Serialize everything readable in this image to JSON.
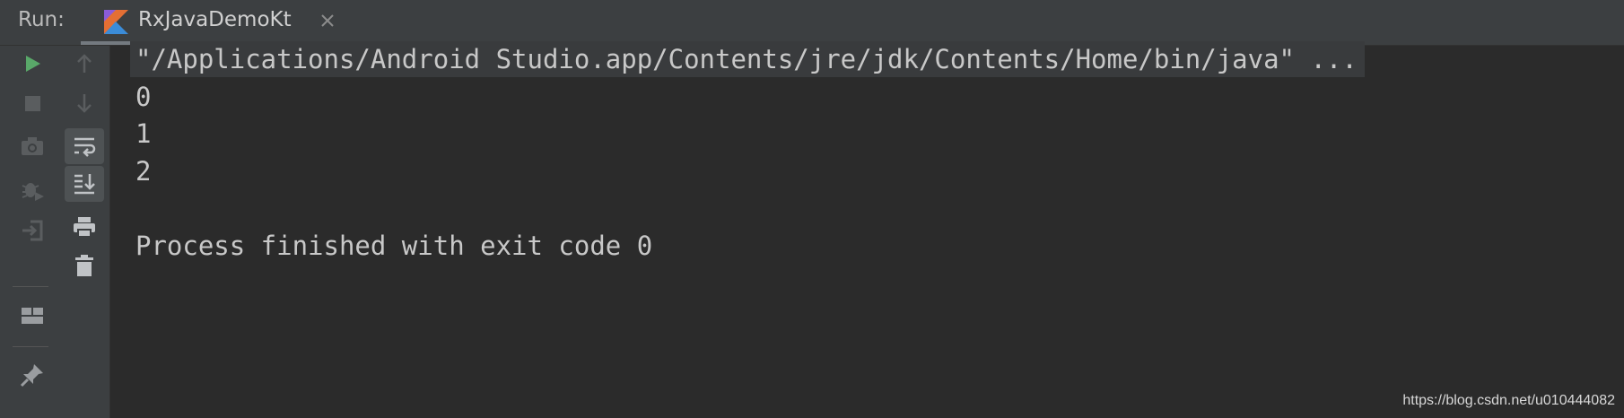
{
  "header": {
    "run_label": "Run:",
    "tab": {
      "title": "RxJavaDemoKt",
      "icon": "kotlin-file-icon",
      "close_icon": "close-icon"
    }
  },
  "toolbar_left": [
    {
      "name": "rerun-button",
      "icon": "play-icon",
      "color": "#59a869"
    },
    {
      "name": "stop-button",
      "icon": "stop-icon"
    },
    {
      "name": "dump-threads-button",
      "icon": "camera-icon"
    },
    {
      "name": "debug-button",
      "icon": "debug-icon"
    },
    {
      "name": "exit-button",
      "icon": "exit-icon"
    },
    {
      "name": "restore-layout-button",
      "icon": "layout-icon"
    },
    {
      "name": "pin-tab-button",
      "icon": "pin-icon"
    }
  ],
  "toolbar_right": [
    {
      "name": "up-button",
      "icon": "arrow-up-icon"
    },
    {
      "name": "down-button",
      "icon": "arrow-down-icon"
    },
    {
      "name": "soft-wrap-button",
      "icon": "soft-wrap-icon",
      "active": true
    },
    {
      "name": "scroll-to-end-button",
      "icon": "scroll-to-end-icon",
      "active": true
    },
    {
      "name": "print-button",
      "icon": "print-icon"
    },
    {
      "name": "clear-all-button",
      "icon": "trash-icon"
    }
  ],
  "console": {
    "command": "\"/Applications/Android Studio.app/Contents/jre/jdk/Contents/Home/bin/java\" ...",
    "output": [
      "0",
      "1",
      "2"
    ],
    "exit_message": "Process finished with exit code 0"
  },
  "watermark": "https://blog.csdn.net/u010444082",
  "colors": {
    "background": "#2b2b2b",
    "toolbar": "#3c3f41",
    "text": "#c8c8c8",
    "run_green": "#59a869",
    "kotlin_orange": "#e44857",
    "kotlin_blue": "#3b8cd8"
  }
}
